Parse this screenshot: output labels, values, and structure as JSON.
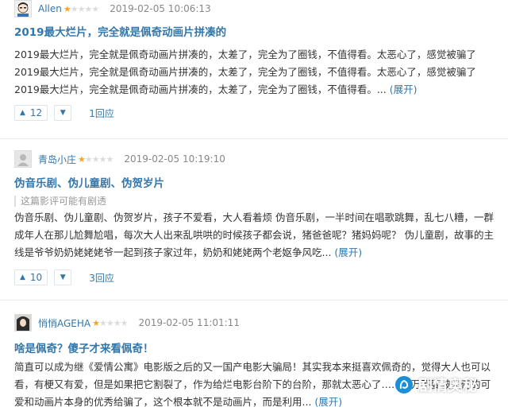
{
  "reviews": [
    {
      "username": "Allen",
      "rating": 1,
      "time": "2019-02-05 10:06:13",
      "title": "2019最大烂片，完全就是佩奇动画片拼凑的",
      "body": "2019最大烂片，完全就是佩奇动画片拼凑的，太差了，完全为了圈钱，不值得看。太恶心了，感觉被骗了2019最大烂片，完全就是佩奇动画片拼凑的，太差了，完全为了圈钱，不值得看。太恶心了，感觉被骗了2019最大烂片，完全就是佩奇动画片拼凑的，太差了，完全为了圈钱，不值得看。...",
      "expand_label": "(展开)",
      "spoiler": "",
      "up_count": "12",
      "reply_label": "1回应"
    },
    {
      "username": "青岛小庄",
      "rating": 1,
      "time": "2019-02-05 10:19:10",
      "title": "伪音乐剧、伪儿童剧、伪贺岁片",
      "spoiler": "这篇影评可能有剧透",
      "body": "伪音乐剧、伪儿童剧、伪贺岁片，孩子不爱看，大人看着烦 伪音乐剧，一半时间在唱歌跳舞，乱七八糟，一群成年人在那儿尬舞尬唱，每次大人出来乱哄哄的时候孩子都会说，猪爸爸呢？猪妈妈呢？ 伪儿童剧，故事的主线是爷爷奶奶姥姥姥爷一起到孩子家过年，奶奶和姥姥两个老妪争风吃...",
      "expand_label": "(展开)",
      "up_count": "10",
      "reply_label": "3回应"
    },
    {
      "username": "悄悄AGEHA",
      "rating": 1,
      "time": "2019-02-05 11:01:11",
      "title": "啥是佩奇？傻子才来看佩奇！",
      "spoiler": "",
      "body": "简直可以成为继《爱情公寓》电影版之后的又一国产电影大骗局！其实我本来挺喜欢佩奇的，觉得大人也可以看，有梗又有爱，但是如果把它割裂了，作为给烂电影台阶下的台阶，那就太恶心了……千万不要被佩奇的可爱和动画片本身的优秀给骗了，这个根本就不是动画片，而是利用...",
      "expand_label": "(展开)",
      "up_count": "",
      "reply_label": ""
    }
  ],
  "icons": {
    "up": "▲",
    "down": "▼",
    "star_on": "★",
    "star_off": "★"
  },
  "watermark": {
    "text": "剧情奥秘"
  },
  "colors": {
    "link": "#3377aa",
    "star": "#f5a623",
    "watermark_logo": "#1a8fd8"
  }
}
